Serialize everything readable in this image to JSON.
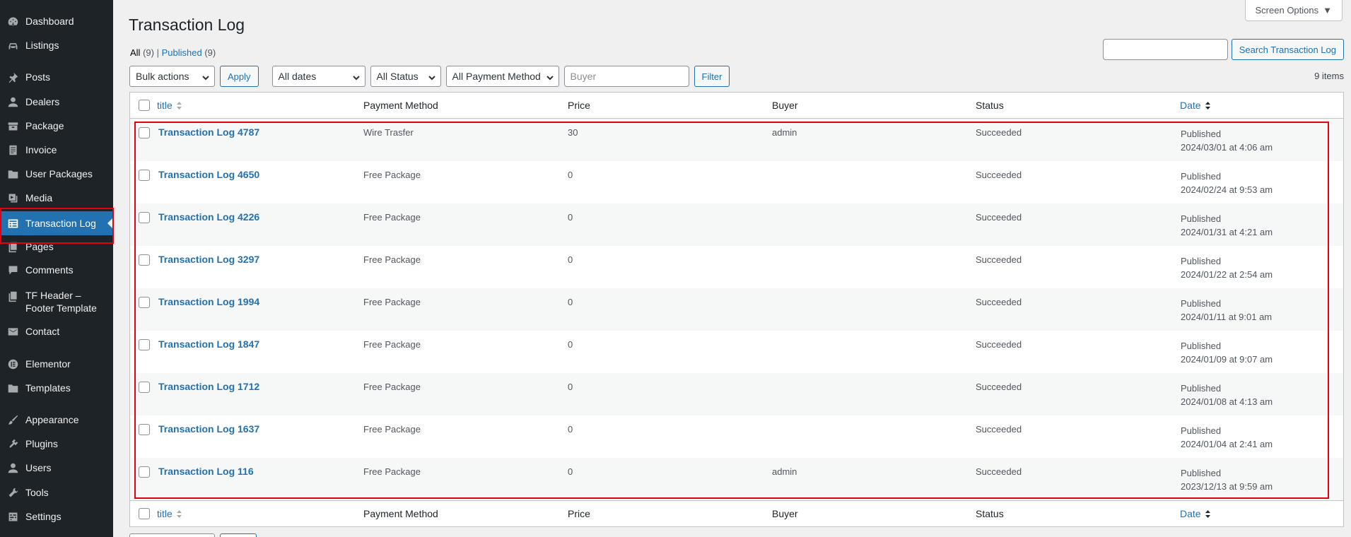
{
  "sidebar": {
    "items": [
      {
        "label": "Dashboard",
        "icon": "dashboard-icon"
      },
      {
        "label": "Listings",
        "icon": "listings-icon"
      },
      {
        "label": "Posts",
        "icon": "pin-icon"
      },
      {
        "label": "Dealers",
        "icon": "user-icon"
      },
      {
        "label": "Package",
        "icon": "package-icon"
      },
      {
        "label": "Invoice",
        "icon": "invoice-icon"
      },
      {
        "label": "User Packages",
        "icon": "folder-icon"
      },
      {
        "label": "Media",
        "icon": "media-icon"
      },
      {
        "label": "Transaction Log",
        "icon": "table-icon"
      },
      {
        "label": "Pages",
        "icon": "page-icon"
      },
      {
        "label": "Comments",
        "icon": "comment-icon"
      },
      {
        "label": "TF Header – Footer Template",
        "icon": "template-icon"
      },
      {
        "label": "Contact",
        "icon": "mail-icon"
      },
      {
        "label": "Elementor",
        "icon": "elementor-icon"
      },
      {
        "label": "Templates",
        "icon": "folder-icon"
      },
      {
        "label": "Appearance",
        "icon": "brush-icon"
      },
      {
        "label": "Plugins",
        "icon": "plugin-icon"
      },
      {
        "label": "Users",
        "icon": "user-icon"
      },
      {
        "label": "Tools",
        "icon": "wrench-icon"
      },
      {
        "label": "Settings",
        "icon": "settings-icon"
      }
    ]
  },
  "header": {
    "screen_options": "Screen Options",
    "title": "Transaction Log"
  },
  "views": {
    "all_label": "All",
    "all_count": "(9)",
    "sep": "|",
    "published_label": "Published",
    "published_count": "(9)"
  },
  "search": {
    "button": "Search Transaction Log"
  },
  "filters": {
    "bulk_actions": "Bulk actions",
    "apply": "Apply",
    "dates": "All dates",
    "status": "All Status",
    "payment": "All Payment Method",
    "buyer_placeholder": "Buyer",
    "filter": "Filter"
  },
  "items_count": "9 items",
  "columns": {
    "title": "title",
    "payment": "Payment Method",
    "price": "Price",
    "buyer": "Buyer",
    "status": "Status",
    "date": "Date"
  },
  "rows": [
    {
      "title": "Transaction Log 4787",
      "payment": "Wire Trasfer",
      "price": "30",
      "buyer": "admin",
      "status": "Succeeded",
      "date_status": "Published",
      "date": "2024/03/01 at 4:06 am"
    },
    {
      "title": "Transaction Log 4650",
      "payment": "Free Package",
      "price": "0",
      "buyer": "",
      "status": "Succeeded",
      "date_status": "Published",
      "date": "2024/02/24 at 9:53 am"
    },
    {
      "title": "Transaction Log 4226",
      "payment": "Free Package",
      "price": "0",
      "buyer": "",
      "status": "Succeeded",
      "date_status": "Published",
      "date": "2024/01/31 at 4:21 am"
    },
    {
      "title": "Transaction Log 3297",
      "payment": "Free Package",
      "price": "0",
      "buyer": "",
      "status": "Succeeded",
      "date_status": "Published",
      "date": "2024/01/22 at 2:54 am"
    },
    {
      "title": "Transaction Log 1994",
      "payment": "Free Package",
      "price": "0",
      "buyer": "",
      "status": "Succeeded",
      "date_status": "Published",
      "date": "2024/01/11 at 9:01 am"
    },
    {
      "title": "Transaction Log 1847",
      "payment": "Free Package",
      "price": "0",
      "buyer": "",
      "status": "Succeeded",
      "date_status": "Published",
      "date": "2024/01/09 at 9:07 am"
    },
    {
      "title": "Transaction Log 1712",
      "payment": "Free Package",
      "price": "0",
      "buyer": "",
      "status": "Succeeded",
      "date_status": "Published",
      "date": "2024/01/08 at 4:13 am"
    },
    {
      "title": "Transaction Log 1637",
      "payment": "Free Package",
      "price": "0",
      "buyer": "",
      "status": "Succeeded",
      "date_status": "Published",
      "date": "2024/01/04 at 2:41 am"
    },
    {
      "title": "Transaction Log 116",
      "payment": "Free Package",
      "price": "0",
      "buyer": "admin",
      "status": "Succeeded",
      "date_status": "Published",
      "date": "2023/12/13 at 9:59 am"
    }
  ],
  "colors": {
    "sidebar_bg": "#1d2327",
    "accent": "#2271b1",
    "highlight": "#e3000f"
  }
}
